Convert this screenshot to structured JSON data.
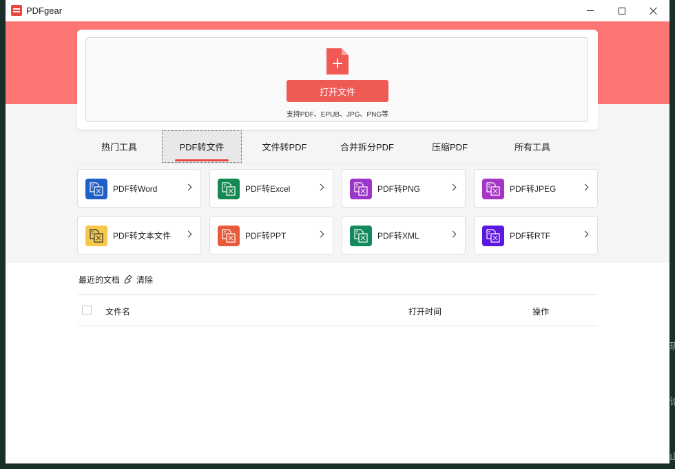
{
  "window": {
    "title": "PDFgear",
    "controls": {
      "minimize": "minimize-icon",
      "maximize": "maximize-icon",
      "close": "close-icon"
    }
  },
  "upload": {
    "icon": "file-plus-icon",
    "open_button": "打开文件",
    "support_text": "支持PDF、EPUB、JPG、PNG等"
  },
  "tabs": [
    {
      "label": "热门工具",
      "active": false
    },
    {
      "label": "PDF转文件",
      "active": true
    },
    {
      "label": "文件转PDF",
      "active": false
    },
    {
      "label": "合并拆分PDF",
      "active": false
    },
    {
      "label": "压缩PDF",
      "active": false
    },
    {
      "label": "所有工具",
      "active": false
    }
  ],
  "accent_color": "#e8463f",
  "tools": [
    {
      "label": "PDF转Word",
      "icon": "word-icon",
      "color": "#1f5fc7"
    },
    {
      "label": "PDF转Excel",
      "icon": "excel-icon",
      "color": "#148a52"
    },
    {
      "label": "PDF转PNG",
      "icon": "png-icon",
      "color": "#9c35c9"
    },
    {
      "label": "PDF转JPEG",
      "icon": "jpeg-icon",
      "color": "#a535c7"
    },
    {
      "label": "PDF转文本文件",
      "icon": "text-icon",
      "color": "#f5c84a"
    },
    {
      "label": "PDF转PPT",
      "icon": "ppt-icon",
      "color": "#e85a3a"
    },
    {
      "label": "PDF转XML",
      "icon": "xml-icon",
      "color": "#138a5c"
    },
    {
      "label": "PDF转RTF",
      "icon": "rtf-icon",
      "color": "#5b18e0"
    }
  ],
  "recent": {
    "label": "最近的文档",
    "clear_label": "清除",
    "columns": {
      "name": "文件名",
      "open_time": "打开时间",
      "action": "操作"
    }
  },
  "edge_glyphs": [
    "玥",
    "论",
    "山"
  ]
}
